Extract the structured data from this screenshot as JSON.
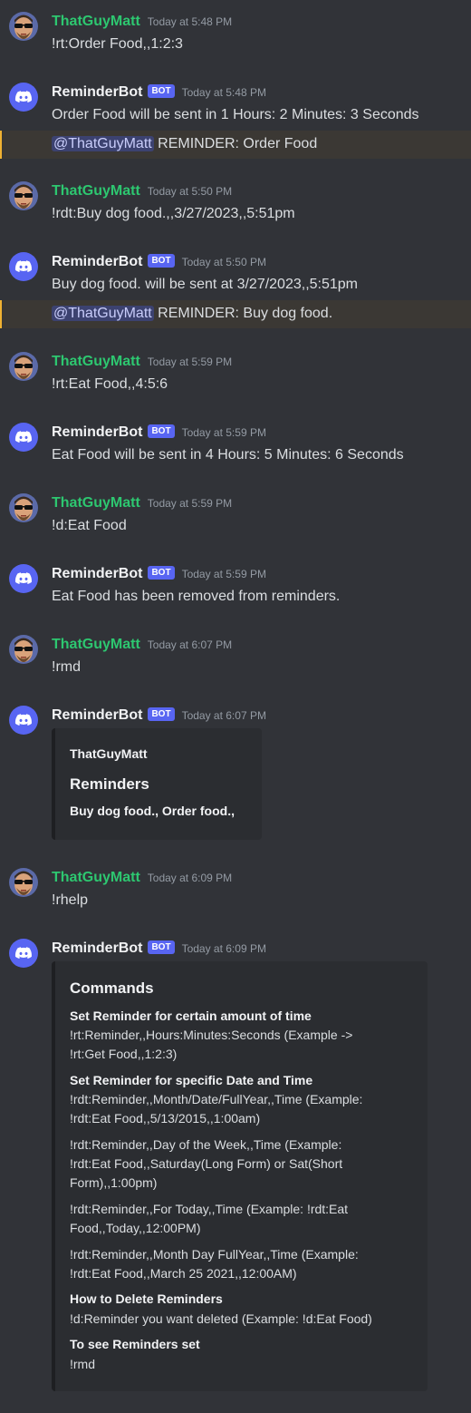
{
  "users": {
    "human": {
      "name": "ThatGuyMatt"
    },
    "bot": {
      "name": "ReminderBot",
      "tag": "BOT"
    }
  },
  "colors": {
    "background": "#313338",
    "user_name": "#2dc770",
    "bot_tag": "#5865f2",
    "mention_bg": "#3c4270",
    "highlight_bar": "#f0b232"
  },
  "icons": {
    "human_avatar": "sunglasses-avatar-icon",
    "bot_avatar": "discord-logo-icon"
  },
  "messages": [
    {
      "time": "Today at 5:48 PM",
      "text": "!rt:Order Food,,1:2:3"
    },
    {
      "time": "Today at 5:48 PM",
      "text": "Order Food will be sent in 1 Hours: 2 Minutes: 3 Seconds",
      "mention": "@ThatGuyMatt",
      "mention_text": "REMINDER: Order Food"
    },
    {
      "time": "Today at 5:50 PM",
      "text": "!rdt:Buy dog food.,,3/27/2023,,5:51pm"
    },
    {
      "time": "Today at 5:50 PM",
      "text": "Buy dog food. will be sent at 3/27/2023,,5:51pm",
      "mention": "@ThatGuyMatt",
      "mention_text": "REMINDER: Buy dog food."
    },
    {
      "time": "Today at 5:59 PM",
      "text": "!rt:Eat Food,,4:5:6"
    },
    {
      "time": "Today at 5:59 PM",
      "text": "Eat Food will be sent in 4 Hours: 5 Minutes: 6 Seconds"
    },
    {
      "time": "Today at 5:59 PM",
      "text": "!d:Eat Food"
    },
    {
      "time": "Today at 5:59 PM",
      "text": "Eat Food has been removed from reminders."
    },
    {
      "time": "Today at 6:07 PM",
      "text": "!rmd"
    },
    {
      "time": "Today at 6:07 PM"
    },
    {
      "time": "Today at 6:09 PM",
      "text": "!rhelp"
    },
    {
      "time": "Today at 6:09 PM"
    }
  ],
  "reminders_embed": {
    "author": "ThatGuyMatt",
    "title": "Reminders",
    "value": "Buy dog food., Order food.,"
  },
  "commands_embed": {
    "title": "Commands",
    "fields": [
      {
        "name": "Set Reminder for certain amount of time",
        "values": [
          "!rt:Reminder,,Hours:Minutes:Seconds (Example ->",
          "!rt:Get Food,,1:2:3)"
        ]
      },
      {
        "name": "Set Reminder for specific Date and Time",
        "values": [
          "!rdt:Reminder,,Month/Date/FullYear,,Time (Example:",
          "!rdt:Eat Food,,5/13/2015,,1:00am)"
        ]
      },
      {
        "name": "",
        "values": [
          "!rdt:Reminder,,Day of the Week,,Time (Example:",
          "!rdt:Eat Food,,Saturday(Long Form) or Sat(Short",
          "Form),,1:00pm)"
        ]
      },
      {
        "name": "",
        "values": [
          "!rdt:Reminder,,For Today,,Time (Example: !rdt:Eat",
          "Food,,Today,,12:00PM)"
        ]
      },
      {
        "name": "",
        "values": [
          "!rdt:Reminder,,Month Day FullYear,,Time (Example:",
          "!rdt:Eat Food,,March 25 2021,,12:00AM)"
        ]
      },
      {
        "name": "How to Delete Reminders",
        "values": [
          "!d:Reminder you want deleted (Example: !d:Eat Food)"
        ]
      },
      {
        "name": "To see Reminders set",
        "values": [
          "!rmd"
        ]
      }
    ]
  }
}
